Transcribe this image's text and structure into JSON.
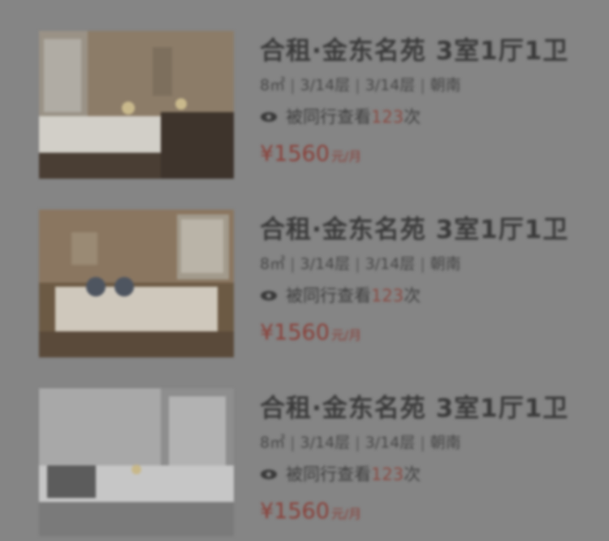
{
  "listings": [
    {
      "title": "合租·金东名苑 3室1厅1卫",
      "meta": [
        "8㎡",
        "3/14层",
        "3/14层",
        "朝南"
      ],
      "views_prefix": "被同行查看",
      "views_count": "123",
      "views_suffix": "次",
      "price": "¥1560",
      "price_unit": "元/月",
      "photo_icon": "bedroom-photo"
    },
    {
      "title": "合租·金东名苑 3室1厅1卫",
      "meta": [
        "8㎡",
        "3/14层",
        "3/14层",
        "朝南"
      ],
      "views_prefix": "被同行查看",
      "views_count": "123",
      "views_suffix": "次",
      "price": "¥1560",
      "price_unit": "元/月",
      "photo_icon": "bedroom-photo"
    },
    {
      "title": "合租·金东名苑 3室1厅1卫",
      "meta": [
        "8㎡",
        "3/14层",
        "3/14层",
        "朝南"
      ],
      "views_prefix": "被同行查看",
      "views_count": "123",
      "views_suffix": "次",
      "price": "¥1560",
      "price_unit": "元/月",
      "photo_icon": "bedroom-photo"
    }
  ],
  "colors": {
    "overlay": "#858585",
    "price": "#8a3f38",
    "title": "#3a3a3a"
  }
}
